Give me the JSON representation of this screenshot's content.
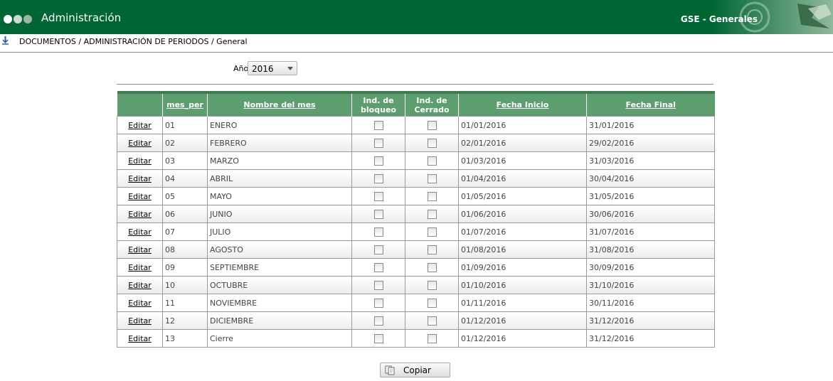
{
  "header": {
    "title": "Administración",
    "brand": "GSE - Generales",
    "bg_color": "#006633"
  },
  "breadcrumb": {
    "icon": "info-download-icon",
    "text": "DOCUMENTOS / ADMINISTRACIÓN DE PERIODOS / General"
  },
  "filter": {
    "year_label": "Año",
    "year_value": "2016"
  },
  "table": {
    "headers": {
      "mes_per": "mes_per",
      "nombre": "Nombre del mes",
      "ind_bloqueo_1": "Ind. de",
      "ind_bloqueo_2": "bloqueo",
      "ind_cerrado_1": "Ind. de",
      "ind_cerrado_2": "Cerrado",
      "fecha_inicio": "Fecha Inicio",
      "fecha_final": "Fecha Final"
    },
    "edit_label": "Editar",
    "rows": [
      {
        "mes": "01",
        "nombre": "ENERO",
        "inicio": "01/01/2016",
        "final": "31/01/2016",
        "bloqueo": false,
        "cerrado": false
      },
      {
        "mes": "02",
        "nombre": "FEBRERO",
        "inicio": "02/01/2016",
        "final": "29/02/2016",
        "bloqueo": false,
        "cerrado": false
      },
      {
        "mes": "03",
        "nombre": "MARZO",
        "inicio": "01/03/2016",
        "final": "31/03/2016",
        "bloqueo": false,
        "cerrado": false
      },
      {
        "mes": "04",
        "nombre": "ABRIL",
        "inicio": "01/04/2016",
        "final": "30/04/2016",
        "bloqueo": false,
        "cerrado": false
      },
      {
        "mes": "05",
        "nombre": "MAYO",
        "inicio": "01/05/2016",
        "final": "31/05/2016",
        "bloqueo": false,
        "cerrado": false
      },
      {
        "mes": "06",
        "nombre": "JUNIO",
        "inicio": "01/06/2016",
        "final": "30/06/2016",
        "bloqueo": false,
        "cerrado": false
      },
      {
        "mes": "07",
        "nombre": "JULIO",
        "inicio": "01/07/2016",
        "final": "31/07/2016",
        "bloqueo": false,
        "cerrado": false
      },
      {
        "mes": "08",
        "nombre": "AGOSTO",
        "inicio": "01/08/2016",
        "final": "31/08/2016",
        "bloqueo": false,
        "cerrado": false
      },
      {
        "mes": "09",
        "nombre": "SEPTIEMBRE",
        "inicio": "01/09/2016",
        "final": "30/09/2016",
        "bloqueo": false,
        "cerrado": false
      },
      {
        "mes": "10",
        "nombre": "OCTUBRE",
        "inicio": "01/10/2016",
        "final": "31/10/2016",
        "bloqueo": false,
        "cerrado": false
      },
      {
        "mes": "11",
        "nombre": "NOVIEMBRE",
        "inicio": "01/11/2016",
        "final": "30/11/2016",
        "bloqueo": false,
        "cerrado": false
      },
      {
        "mes": "12",
        "nombre": "DICIEMBRE",
        "inicio": "01/12/2016",
        "final": "31/12/2016",
        "bloqueo": false,
        "cerrado": false
      },
      {
        "mes": "13",
        "nombre": "Cierre",
        "inicio": "01/12/2016",
        "final": "31/12/2016",
        "bloqueo": false,
        "cerrado": false
      }
    ]
  },
  "actions": {
    "copy_label": "Copiar",
    "copy_icon": "copy-documents-icon"
  }
}
